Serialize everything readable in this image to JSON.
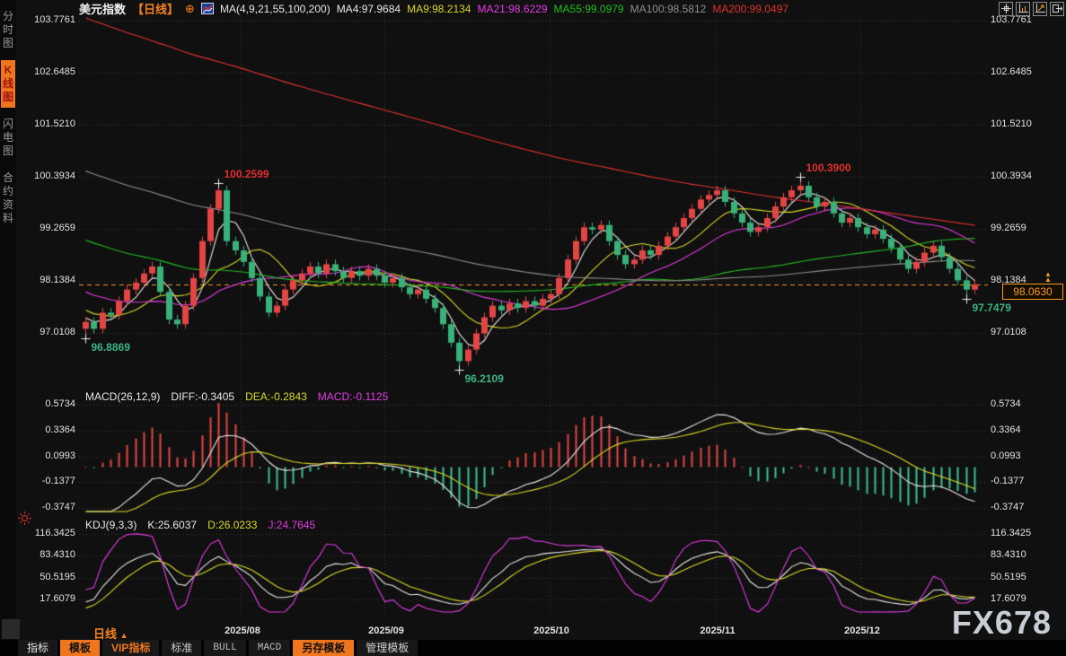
{
  "window": {
    "watermark": "FX678"
  },
  "sidebar": {
    "items": [
      {
        "label": "分时图",
        "active": false
      },
      {
        "label": "K线图",
        "active": true
      },
      {
        "label": "闪电图",
        "active": false
      },
      {
        "label": "合约资料",
        "active": false
      }
    ]
  },
  "header": {
    "title": "美元指数",
    "period": "【日线】",
    "ma_title": "MA(4,9,21,55,100,200)",
    "ma_values": [
      {
        "label": "MA4:97.9684"
      },
      {
        "label": "MA9:98.2134"
      },
      {
        "label": "MA21:98.6229"
      },
      {
        "label": "MA55:99.0979"
      },
      {
        "label": "MA100:98.5812"
      },
      {
        "label": "MA200:99.0497"
      }
    ],
    "tool_icons": [
      "crosshair-icon",
      "axis-scale-icon",
      "axis-shift-icon",
      "exit-right-icon"
    ]
  },
  "main_pane": {
    "tick_labels": [
      "103.7761",
      "102.6485",
      "101.5210",
      "100.3934",
      "99.2659",
      "98.1384",
      "97.0108"
    ],
    "last_label": "98.0630"
  },
  "macd_pane": {
    "name": "MACD(26,12,9)",
    "diff": "DIFF:-0.3405",
    "dea": "DEA:-0.2843",
    "macd": "MACD:-0.1125",
    "tick_labels": [
      "0.5734",
      "0.3364",
      "0.0993",
      "-0.1377",
      "-0.3747"
    ]
  },
  "kdj_pane": {
    "name": "KDJ(9,3,3)",
    "k": "K:25.6037",
    "d": "D:26.0233",
    "j": "J:24.7645",
    "tick_labels": [
      "116.3425",
      "83.4310",
      "50.5195",
      "17.6079"
    ]
  },
  "xaxis": {
    "period_label": "日线",
    "period_arrow": "▲"
  },
  "bottom_tabs": [
    {
      "label": "指标",
      "style": "plain"
    },
    {
      "label": "模板",
      "style": "orange"
    },
    {
      "label": "VIP指标",
      "style": "orange-text"
    },
    {
      "label": "标准",
      "style": "plain2"
    },
    {
      "label": "BULL",
      "style": "mono"
    },
    {
      "label": "MACD",
      "style": "mono"
    },
    {
      "label": "另存模板",
      "style": "orange"
    },
    {
      "label": "管理模板",
      "style": "plain2"
    }
  ],
  "colors": {
    "up": "#e34545",
    "down": "#38b279",
    "accent_orange": "#f59a23",
    "ma": [
      "#e8e8e8",
      "#d8d82a",
      "#e23ce2",
      "#22bb22",
      "#8f8f8f",
      "#e03030"
    ],
    "diff": "#e8e8e8",
    "dea": "#d8d82a",
    "hist_pos": "#e34545",
    "hist_neg": "#3cbf96",
    "k": "#e8e8e8",
    "d": "#d8d82a",
    "j": "#e23ce2",
    "grid": "#3c3c3c",
    "axis_text": "#e2e2e2"
  },
  "chart_data": {
    "type": "candlestick",
    "symbol": "美元指数",
    "interval": "日线",
    "ma_windows": [
      4,
      9,
      21,
      55,
      100,
      200
    ],
    "ma_current": [
      97.9684,
      98.2134,
      98.6229,
      99.0979,
      98.5812,
      99.0497
    ],
    "closes": [
      97.25,
      97.1,
      97.45,
      97.4,
      97.7,
      97.95,
      98.1,
      98.3,
      98.45,
      97.9,
      97.3,
      97.2,
      97.6,
      98.2,
      99.0,
      99.7,
      100.1,
      99.0,
      98.8,
      98.55,
      98.2,
      97.8,
      97.45,
      97.6,
      97.95,
      98.15,
      98.3,
      98.45,
      98.3,
      98.5,
      98.35,
      98.2,
      98.35,
      98.25,
      98.4,
      98.25,
      98.1,
      98.2,
      98.0,
      97.85,
      97.95,
      97.75,
      97.55,
      97.2,
      96.8,
      96.4,
      96.65,
      97.0,
      97.35,
      97.6,
      97.5,
      97.65,
      97.55,
      97.7,
      97.6,
      97.75,
      97.85,
      98.2,
      98.6,
      99.0,
      99.3,
      99.25,
      99.35,
      99.0,
      98.7,
      98.5,
      98.6,
      98.8,
      98.7,
      98.9,
      99.1,
      99.3,
      99.5,
      99.7,
      99.9,
      100.0,
      100.1,
      99.85,
      99.6,
      99.4,
      99.2,
      99.3,
      99.5,
      99.75,
      99.95,
      100.1,
      100.2,
      99.95,
      99.75,
      99.85,
      99.6,
      99.4,
      99.5,
      99.3,
      99.15,
      99.25,
      99.05,
      98.85,
      98.6,
      98.4,
      98.55,
      98.75,
      98.9,
      98.65,
      98.4,
      98.15,
      97.95,
      98.063
    ],
    "wick_overrides": {
      "0": {
        "low": 96.8869
      },
      "16": {
        "high": 100.2599
      },
      "45": {
        "low": 96.2109
      },
      "86": {
        "high": 100.39
      },
      "106": {
        "low": 97.7479
      }
    },
    "last_price": 98.063,
    "main_ticks": [
      103.7761,
      102.6485,
      101.521,
      100.3934,
      99.2659,
      98.1384,
      97.0108
    ],
    "macd": {
      "params": [
        26,
        12,
        9
      ],
      "diff": -0.3405,
      "dea": -0.2843,
      "macd": -0.1125,
      "ticks": [
        0.5734,
        0.3364,
        0.0993,
        -0.1377,
        -0.3747
      ]
    },
    "kdj": {
      "params": [
        9,
        3,
        3
      ],
      "k": 25.6037,
      "d": 26.0233,
      "j": 24.7645,
      "ticks": [
        116.3425,
        83.431,
        50.5195,
        17.6079
      ]
    },
    "x_labels": [
      "2025/08",
      "2025/09",
      "2025/10",
      "2025/11",
      "2025/12"
    ],
    "annotations": [
      {
        "text": "100.2599",
        "idx": 16,
        "kind": "high"
      },
      {
        "text": "96.8869",
        "idx": 0,
        "kind": "low"
      },
      {
        "text": "96.2109",
        "idx": 45,
        "kind": "low"
      },
      {
        "text": "100.3900",
        "idx": 86,
        "kind": "high"
      },
      {
        "text": "97.7479",
        "idx": 106,
        "kind": "low"
      }
    ]
  }
}
